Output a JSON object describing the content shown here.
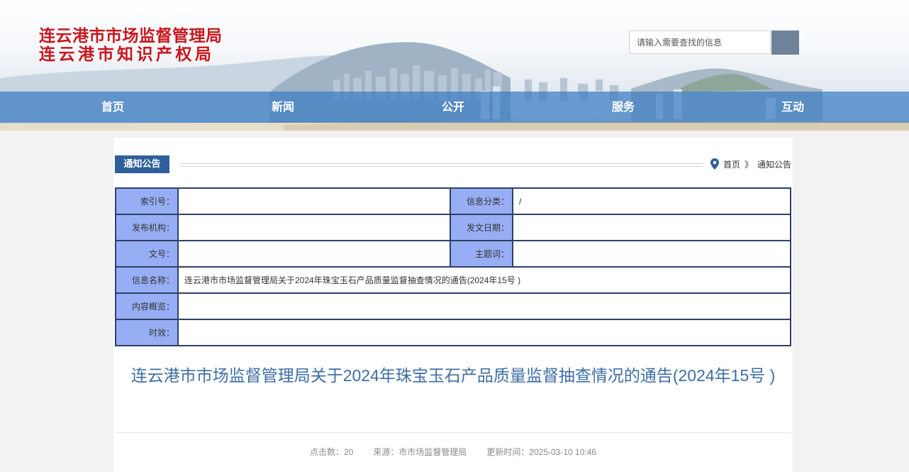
{
  "header": {
    "logo_line1": "连云港市市场监督管理局",
    "logo_line2": "连云港市知识产权局",
    "search_placeholder": "请输入需要查找的信息",
    "search_icon": "search-icon"
  },
  "nav": {
    "items": [
      {
        "label": "首页"
      },
      {
        "label": "新闻"
      },
      {
        "label": "公开"
      },
      {
        "label": "服务"
      },
      {
        "label": "互动"
      }
    ]
  },
  "section": {
    "tag": "通知公告",
    "breadcrumb": {
      "icon": "location-pin-icon",
      "home": "首页",
      "separator": "》",
      "current": "通知公告"
    }
  },
  "info_table": {
    "index_label": "索引号：",
    "index_value": "",
    "category_label": "信息分类：",
    "category_value": "/",
    "publisher_label": "发布机构：",
    "publisher_value": "",
    "date_label": "发文日期：",
    "date_value": "",
    "docno_label": "文号：",
    "docno_value": "",
    "keywords_label": "主题词：",
    "keywords_value": "",
    "name_label": "信息名称：",
    "name_value": "连云港市市场监督管理局关于2024年珠宝玉石产品质量监督抽查情况的通告(2024年15号 )",
    "summary_label": "内容概览：",
    "summary_value": "",
    "validity_label": "时效：",
    "validity_value": ""
  },
  "article": {
    "title": "连云港市市场监督管理局关于2024年珠宝玉石产品质量监督抽查情况的通告(2024年15号 )",
    "clicks": "点击数：20",
    "source": "来源：市市场监督管理局",
    "updated": "更新时间：2025-03-10 10:46"
  },
  "colors": {
    "logo_red": "#c8161d",
    "nav_blue": "#3a7bc3",
    "tag_blue": "#2f5f9a",
    "label_bg": "#97aef5",
    "title_blue": "#3d6ea6"
  }
}
